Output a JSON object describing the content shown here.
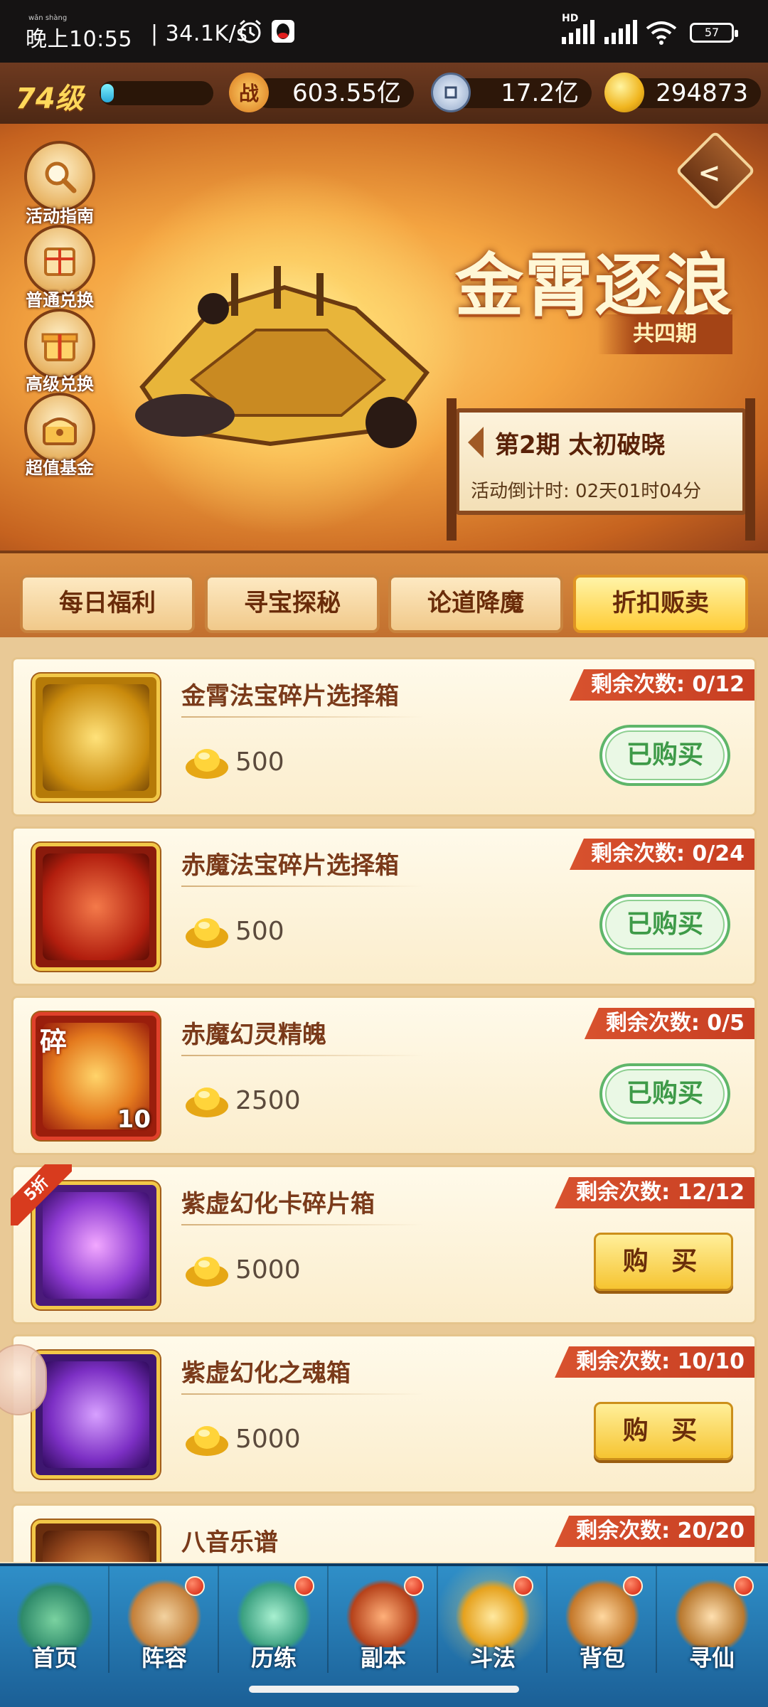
{
  "status_bar": {
    "time": "晚上10:55",
    "pinyin": "wǎn shàng",
    "net_speed": "34.1K/s",
    "network": "HD",
    "battery": "57"
  },
  "resources": {
    "level": "74级",
    "exp_progress": 0.08,
    "power_icon": "战",
    "power": "603.55亿",
    "silver": "17.2亿",
    "gold": "294873"
  },
  "banner": {
    "title": "金霄逐浪",
    "subtitle": "共四期",
    "phase_title": "第2期  太初破晓",
    "countdown": "活动倒计时: 02天01时04分",
    "side_buttons": [
      {
        "label": "活动指南",
        "icon": "magnifier-icon"
      },
      {
        "label": "普通兑换",
        "icon": "gift-box-icon"
      },
      {
        "label": "高级兑换",
        "icon": "gift-icon"
      },
      {
        "label": "超值基金",
        "icon": "treasure-chest-icon"
      }
    ]
  },
  "tabs": [
    {
      "label": "每日福利",
      "active": false
    },
    {
      "label": "寻宝探秘",
      "active": false
    },
    {
      "label": "论道降魔",
      "active": false
    },
    {
      "label": "折扣贩卖",
      "active": true
    }
  ],
  "items": [
    {
      "name": "金霄法宝碎片选择箱",
      "price": "500",
      "remain": "剩余次数: 0/12",
      "button": "已购买",
      "bought": true,
      "color": "#d8a20e"
    },
    {
      "name": "赤魔法宝碎片选择箱",
      "price": "500",
      "remain": "剩余次数: 0/24",
      "button": "已购买",
      "bought": true,
      "color": "#c1301c"
    },
    {
      "name": "赤魔幻灵精魄",
      "price": "2500",
      "remain": "剩余次数: 0/5",
      "button": "已购买",
      "bought": true,
      "color": "#b9321a",
      "shard": "碎",
      "count": "10"
    },
    {
      "name": "紫虚幻化卡碎片箱",
      "price": "5000",
      "remain": "剩余次数: 12/12",
      "button": "购 买",
      "bought": false,
      "color": "#7a36c4",
      "discount": "5折"
    },
    {
      "name": "紫虚幻化之魂箱",
      "price": "5000",
      "remain": "剩余次数: 10/10",
      "button": "购 买",
      "bought": false,
      "color": "#6c2fb8"
    },
    {
      "name": "八音乐谱",
      "price": "",
      "remain": "剩余次数: 20/20",
      "button": "",
      "bought": false,
      "color": "#9a4a1e"
    }
  ],
  "bottom_nav": [
    {
      "label": "首页",
      "dot": false
    },
    {
      "label": "阵容",
      "dot": true
    },
    {
      "label": "历练",
      "dot": true
    },
    {
      "label": "副本",
      "dot": true
    },
    {
      "label": "斗法",
      "dot": true
    },
    {
      "label": "背包",
      "dot": true
    },
    {
      "label": "寻仙",
      "dot": true
    }
  ]
}
